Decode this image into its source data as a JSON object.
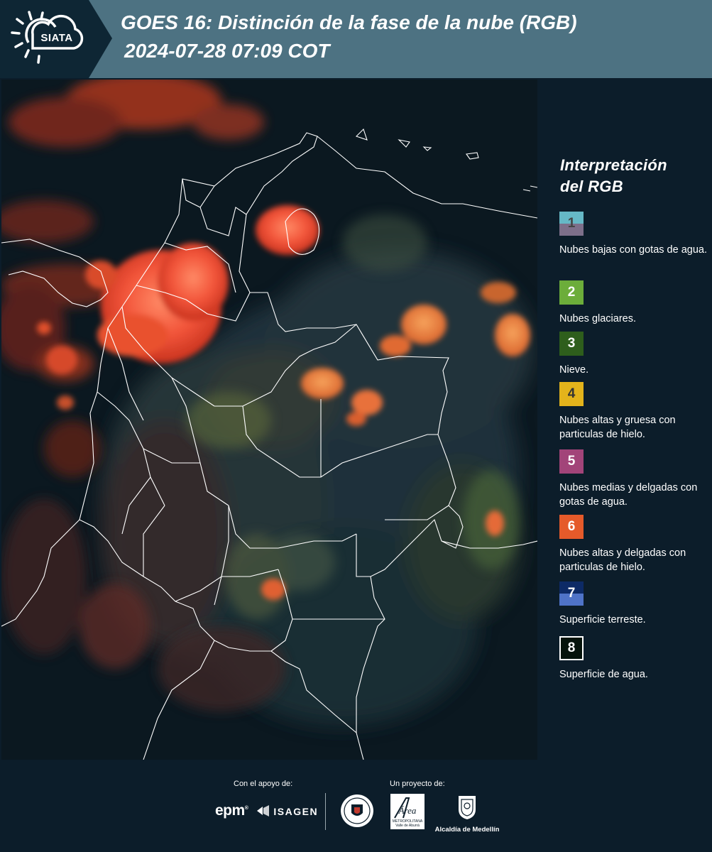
{
  "header": {
    "logo_text": "SIATA",
    "title_line1": "GOES 16: Distinción de la fase de la nube (RGB)",
    "title_line2": "2024-07-28 07:09 COT",
    "background_color": "#4d7282"
  },
  "map": {
    "region": "Colombia",
    "icon_name": "satellite-rgb-map"
  },
  "legend": {
    "title_line1": "Interpretación",
    "title_line2": "del RGB",
    "items": [
      {
        "number": "1",
        "label": "Nubes bajas con gotas de agua.",
        "color_top": "#66b8c6",
        "color_bottom": "#7d6f8a"
      },
      {
        "number": "2",
        "label": "Nubes glaciares.",
        "color": "#6cad3a"
      },
      {
        "number": "3",
        "label": "Nieve.",
        "color": "#2e5e1c"
      },
      {
        "number": "4",
        "label": "Nubes altas y gruesa con particulas de hielo.",
        "color": "#e3b31b"
      },
      {
        "number": "5",
        "label": "Nubes medias y delgadas con gotas de agua.",
        "color": "#a24479"
      },
      {
        "number": "6",
        "label": "Nubes altas y delgadas con particulas de hielo.",
        "color": "#e55a2a"
      },
      {
        "number": "7",
        "label": "Superficie terreste.",
        "color_top": "#0d2a66",
        "color_bottom": "#4f73c8"
      },
      {
        "number": "8",
        "label": "Superficie de agua.",
        "color": "#06130b"
      }
    ]
  },
  "footer": {
    "support_label": "Con el apoyo de:",
    "project_label": "Un proyecto de:",
    "epm_text": "epm",
    "isagen_text": "ISAGEN",
    "area_text": "Área",
    "area_sub1": "METROPOLITANA",
    "area_sub2": "Valle de Aburrá",
    "alcaldia_text": "Alcaldía de Medellín"
  }
}
